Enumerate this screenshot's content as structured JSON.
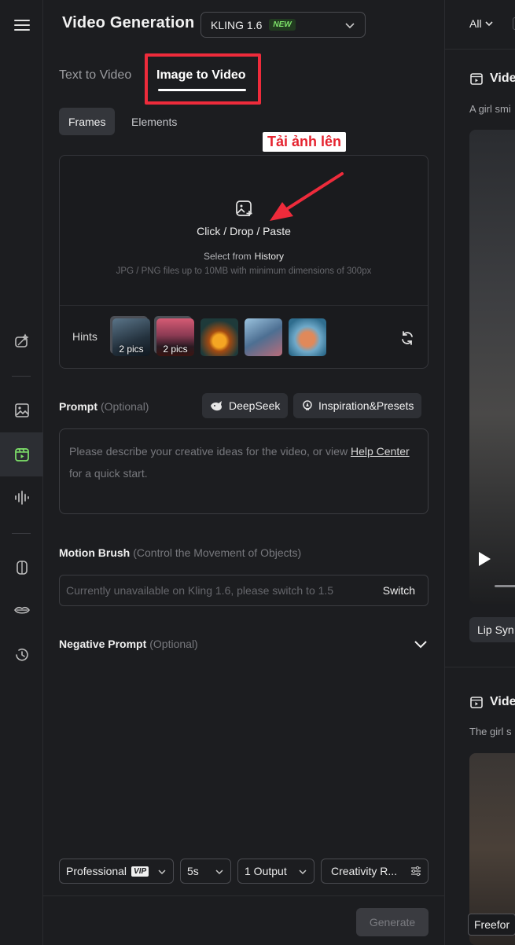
{
  "header": {
    "title": "Video Generation",
    "model": "KLING 1.6",
    "model_badge": "NEW"
  },
  "tabs": {
    "text_to_video": "Text to Video",
    "image_to_video": "Image to Video"
  },
  "subtabs": {
    "frames": "Frames",
    "elements": "Elements"
  },
  "annotation": {
    "callout": "Tải ảnh lên",
    "highlight_color": "#ee2b3b"
  },
  "upload": {
    "action": "Click / Drop / Paste",
    "select_prefix": "Select from",
    "select_link": "History",
    "requirements": "JPG / PNG files up to 10MB with minimum dimensions of 300px",
    "hints_label": "Hints",
    "hints": [
      {
        "count": "2 pics"
      },
      {
        "count": "2 pics"
      },
      {
        "count": ""
      },
      {
        "count": ""
      },
      {
        "count": ""
      }
    ]
  },
  "prompt": {
    "label": "Prompt",
    "optional": "(Optional)",
    "deepseek": "DeepSeek",
    "inspiration": "Inspiration&Presets",
    "placeholder_start": "Please describe your creative ideas for the video, or view",
    "help_link": "Help Center",
    "placeholder_end": "for a quick start."
  },
  "motion_brush": {
    "label": "Motion Brush",
    "hint": "(Control the Movement of Objects)",
    "unavailable": "Currently unavailable on Kling 1.6, please switch to 1.5",
    "switch": "Switch"
  },
  "negative_prompt": {
    "label": "Negative Prompt",
    "optional": "(Optional)"
  },
  "settings": {
    "mode": "Professional",
    "mode_badge": "VIP",
    "duration": "5s",
    "outputs": "1 Output",
    "creativity": "Creativity R..."
  },
  "generate_label": "Generate",
  "feed": {
    "filter": "All",
    "items": [
      {
        "title": "Vide",
        "desc": "A girl smi",
        "action": "Lip Syn"
      },
      {
        "title": "Vide",
        "desc": "The girl s",
        "action": "Freefor"
      }
    ]
  }
}
